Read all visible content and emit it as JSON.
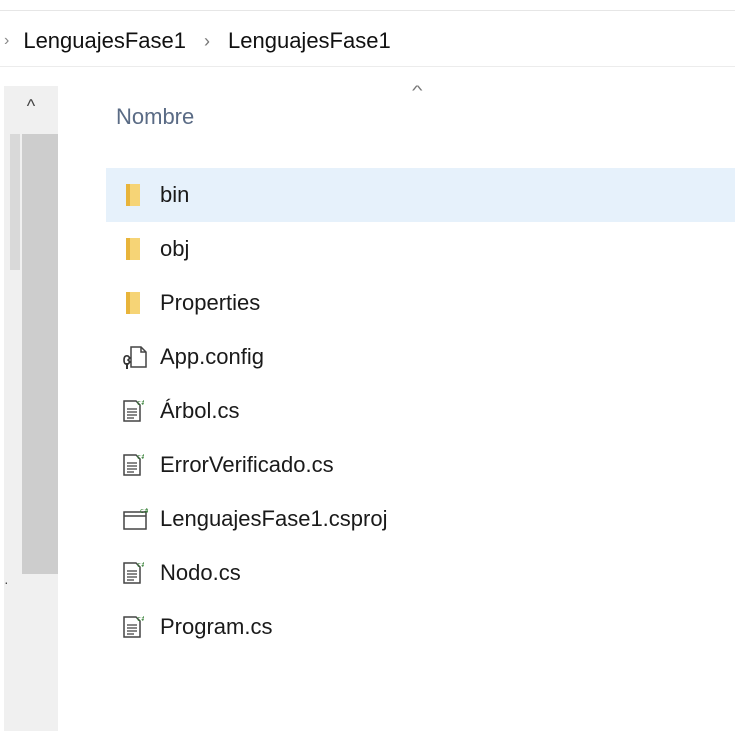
{
  "breadcrumb": {
    "prefix": "›",
    "separator": "›",
    "items": [
      "LenguajesFase1",
      "LenguajesFase1"
    ]
  },
  "scrollbar": {
    "up_arrow": "^"
  },
  "column_header": {
    "name_label": "Nombre",
    "sort_indicator": "^"
  },
  "files": [
    {
      "name": "bin",
      "type": "folder",
      "selected": true
    },
    {
      "name": "obj",
      "type": "folder",
      "selected": false
    },
    {
      "name": "Properties",
      "type": "folder",
      "selected": false
    },
    {
      "name": "App.config",
      "type": "config",
      "selected": false
    },
    {
      "name": "Árbol.cs",
      "type": "cs",
      "selected": false
    },
    {
      "name": "ErrorVerificado.cs",
      "type": "cs",
      "selected": false
    },
    {
      "name": "LenguajesFase1.csproj",
      "type": "csproj",
      "selected": false
    },
    {
      "name": "Nodo.cs",
      "type": "cs",
      "selected": false
    },
    {
      "name": "Program.cs",
      "type": "cs",
      "selected": false
    }
  ],
  "colors": {
    "selection": "#e6f1fb",
    "folder": "#f2c14e",
    "header": "#5a6b85"
  }
}
